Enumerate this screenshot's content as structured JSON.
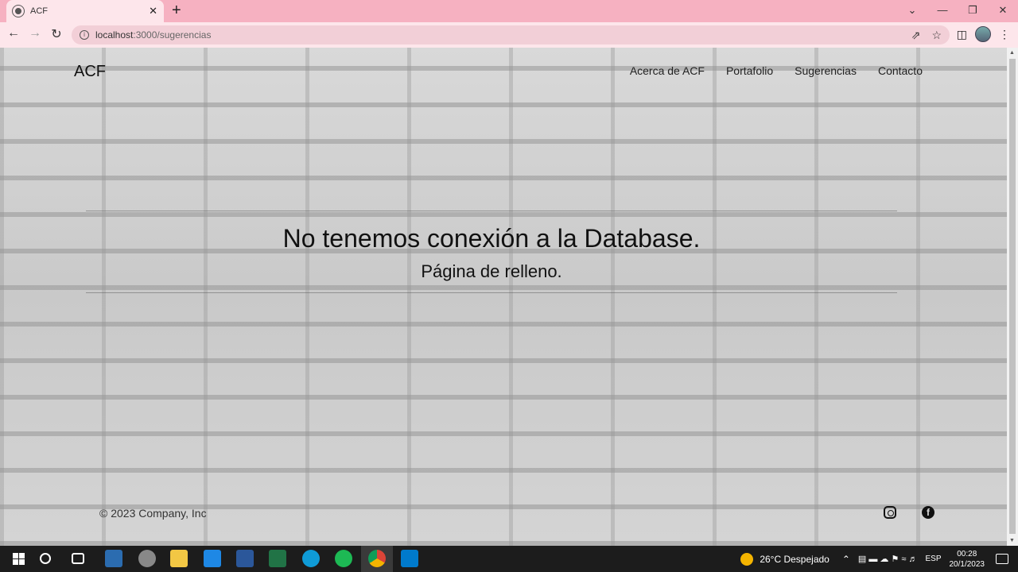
{
  "browser": {
    "tab_title": "ACF",
    "url_host": "localhost",
    "url_path": ":3000/sugerencias",
    "tab_close": "✕",
    "new_tab": "+",
    "window_controls": [
      "⌄",
      "—",
      "❐",
      "✕"
    ]
  },
  "site": {
    "brand": "ACF",
    "nav": [
      "Acerca de ACF",
      "Portafolio",
      "Sugerencias",
      "Contacto"
    ]
  },
  "hero": {
    "title": "No tenemos conexión a la Database.",
    "subtitle": "Página de relleno."
  },
  "footer": {
    "copyright": "© 2023 Company, Inc",
    "social": [
      "instagram-icon",
      "facebook-icon"
    ]
  },
  "taskbar": {
    "weather": "26°C  Despejado",
    "lang": "ESP",
    "time": "00:28",
    "date": "20/1/2023"
  }
}
